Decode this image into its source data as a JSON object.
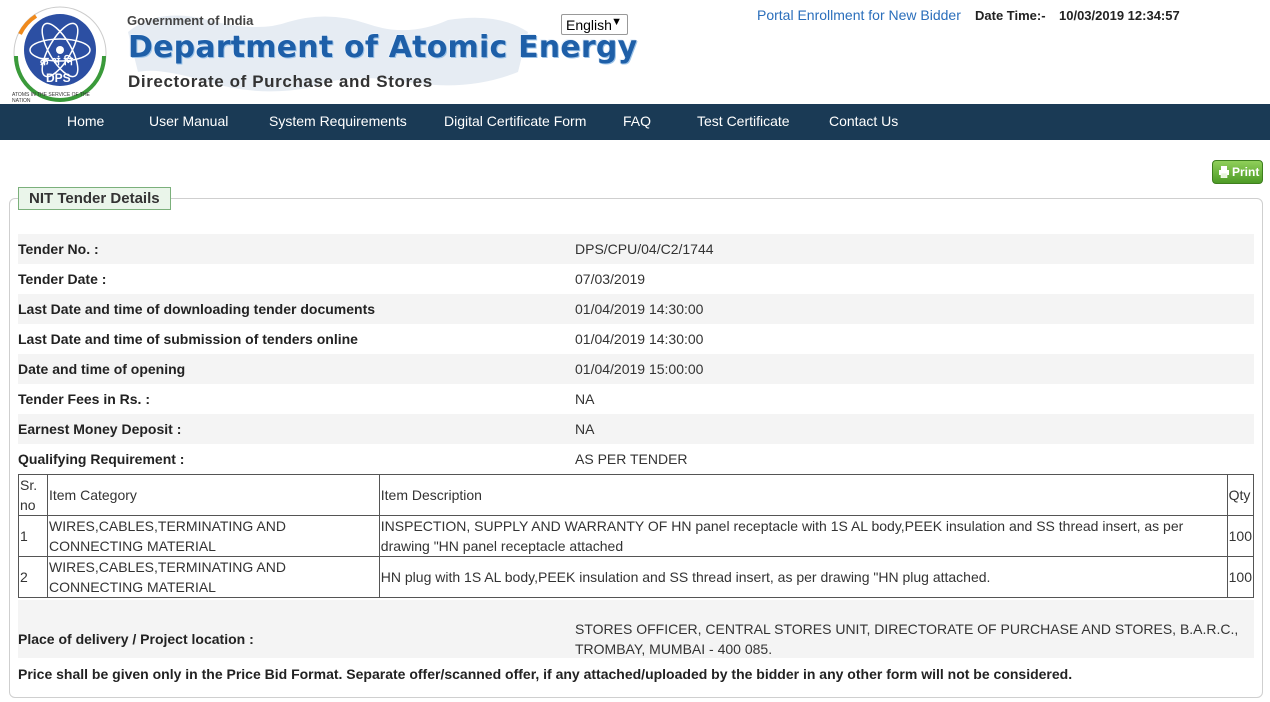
{
  "header": {
    "logo_text": "DPS",
    "logo_hindi": "क्र भं नि",
    "logo_motto": "ATOMS IN THE SERVICE OF THE NATION",
    "government": "Government of India",
    "department": "Department of Atomic Energy",
    "directorate": "Directorate of Purchase and Stores",
    "language": "English",
    "portal_link": "Portal Enrollment for New Bidder",
    "datetime_label": "Date Time:-",
    "datetime_value": "10/03/2019 12:34:57"
  },
  "nav": {
    "items": [
      "Home",
      "User Manual",
      "System Requirements",
      "Digital Certificate Form",
      "FAQ",
      "Test Certificate",
      "Contact Us"
    ]
  },
  "print_label": "Print",
  "section_title": "NIT Tender Details",
  "details": [
    {
      "label": "Tender No. :",
      "value": "DPS/CPU/04/C2/1744"
    },
    {
      "label": "Tender Date :",
      "value": "07/03/2019"
    },
    {
      "label": "Last Date and time of downloading tender documents",
      "value": "01/04/2019 14:30:00"
    },
    {
      "label": "Last Date and time of submission of tenders online",
      "value": "01/04/2019 14:30:00"
    },
    {
      "label": "Date and time of opening",
      "value": "01/04/2019 15:00:00"
    },
    {
      "label": "Tender Fees in Rs. :",
      "value": "NA"
    },
    {
      "label": "Earnest Money Deposit :",
      "value": "NA"
    },
    {
      "label": "Qualifying Requirement :",
      "value": "AS PER TENDER"
    }
  ],
  "items_table": {
    "headers": [
      "Sr. no",
      "Item Category",
      "Item Description",
      "Qty"
    ],
    "rows": [
      [
        "1",
        "WIRES,CABLES,TERMINATING AND CONNECTING MATERIAL",
        "INSPECTION, SUPPLY AND WARRANTY OF HN panel receptacle with 1S AL body,PEEK insulation and SS thread insert, as per drawing \"HN panel receptacle attached",
        "100"
      ],
      [
        "2",
        "WIRES,CABLES,TERMINATING AND CONNECTING MATERIAL",
        "HN plug with 1S AL body,PEEK insulation and SS thread insert, as per drawing \"HN plug attached.",
        "100"
      ]
    ]
  },
  "delivery": {
    "label": "Place of delivery / Project location :",
    "value": "STORES OFFICER, CENTRAL STORES UNIT, DIRECTORATE OF PURCHASE AND STORES, B.A.R.C., TROMBAY, MUMBAI - 400 085."
  },
  "note": "Price shall be given only in the Price Bid Format. Separate offer/scanned offer, if any attached/uploaded by the bidder in any other form will not be considered.",
  "colors": {
    "nav_bg": "#1a3a55",
    "brand_blue": "#1e5fa8",
    "link_blue": "#2a6ebb",
    "print_green": "#4d9b26",
    "legend_bg": "#eaf5ea"
  }
}
